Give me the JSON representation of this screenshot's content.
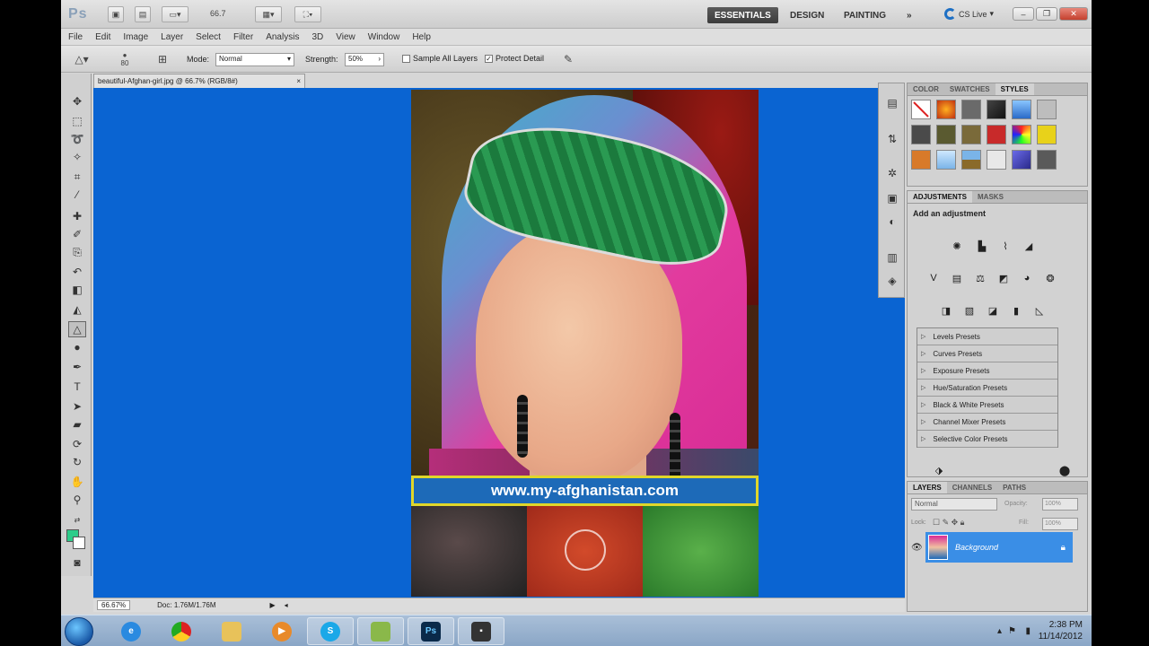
{
  "app": {
    "logo": "Ps",
    "zoom_display": "66.7",
    "workspaces": [
      "ESSENTIALS",
      "DESIGN",
      "PAINTING"
    ],
    "more_workspaces": "»",
    "cs_live": "CS Live"
  },
  "menu": [
    "File",
    "Edit",
    "Image",
    "Layer",
    "Select",
    "Filter",
    "Analysis",
    "3D",
    "View",
    "Window",
    "Help"
  ],
  "options": {
    "brush_size": "80",
    "mode_label": "Mode:",
    "mode_value": "Normal",
    "strength_label": "Strength:",
    "strength_value": "50%",
    "sample_all_layers": "Sample All Layers",
    "protect_detail": "Protect Detail"
  },
  "document": {
    "tab_title": "beautiful-Afghan-girl.jpg @ 66.7% (RGB/8#)",
    "close": "×",
    "banner_text": "www.my-afghanistan.com",
    "status_zoom": "66.67%",
    "status_doc": "Doc: 1.76M/1.76M"
  },
  "panels": {
    "swatch_tabs": [
      "COLOR",
      "SWATCHES",
      "STYLES"
    ],
    "adjust_tabs": [
      "ADJUSTMENTS",
      "MASKS"
    ],
    "add_adjustment": "Add an adjustment",
    "presets": [
      "Levels Presets",
      "Curves Presets",
      "Exposure Presets",
      "Hue/Saturation Presets",
      "Black & White Presets",
      "Channel Mixer Presets",
      "Selective Color Presets"
    ],
    "layer_tabs": [
      "LAYERS",
      "CHANNELS",
      "PATHS"
    ],
    "blend_mode": "Normal",
    "opacity_label": "Opacity:",
    "opacity_value": "100%",
    "lock_label": "Lock:",
    "fill_label": "Fill:",
    "fill_value": "100%",
    "layer_name": "Background"
  },
  "taskbar": {
    "time": "2:38 PM",
    "date": "11/14/2012",
    "ps_glyph": "Ps"
  },
  "colors": {
    "canvas_bg": "#0a64d2",
    "foreground": "#2ecc8a",
    "accent": "#3a8ee6"
  }
}
